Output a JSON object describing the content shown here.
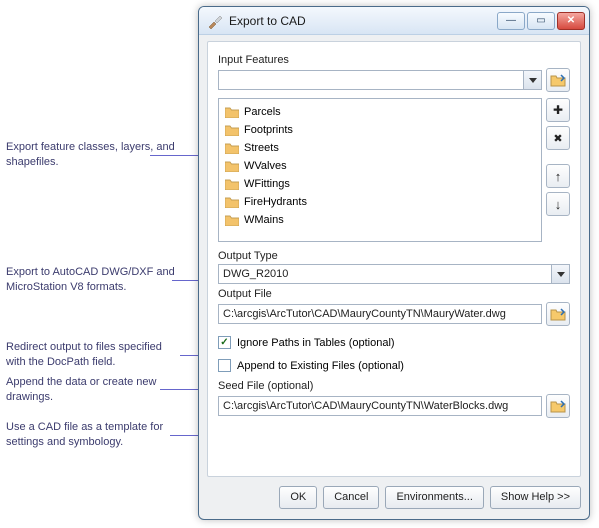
{
  "window": {
    "title": "Export to CAD"
  },
  "labels": {
    "input_features": "Input Features",
    "output_type": "Output Type",
    "output_file": "Output File",
    "seed_file": "Seed File (optional)"
  },
  "input_features": {
    "combo_value": "",
    "items": [
      "Parcels",
      "Footprints",
      "Streets",
      "WValves",
      "WFittings",
      "FireHydrants",
      "WMains"
    ]
  },
  "output_type": {
    "value": "DWG_R2010"
  },
  "output_file": {
    "value": "C:\\arcgis\\ArcTutor\\CAD\\MauryCountyTN\\MauryWater.dwg"
  },
  "options": {
    "ignore_paths_checked": true,
    "ignore_paths_label": "Ignore Paths in Tables (optional)",
    "append_checked": false,
    "append_label": "Append to Existing Files (optional)"
  },
  "seed_file": {
    "value": "C:\\arcgis\\ArcTutor\\CAD\\MauryCountyTN\\WaterBlocks.dwg"
  },
  "buttons": {
    "ok": "OK",
    "cancel": "Cancel",
    "environments": "Environments...",
    "show_help": "Show Help >>"
  },
  "annotations": {
    "a1": "Export feature classes, layers, and shapefiles.",
    "a2": "Export to AutoCAD DWG/DXF and MicroStation V8 formats.",
    "a3": "Redirect output to files specified with the DocPath field.",
    "a4": "Append the data or create new drawings.",
    "a5": "Use a CAD file as a template for settings and symbology."
  }
}
